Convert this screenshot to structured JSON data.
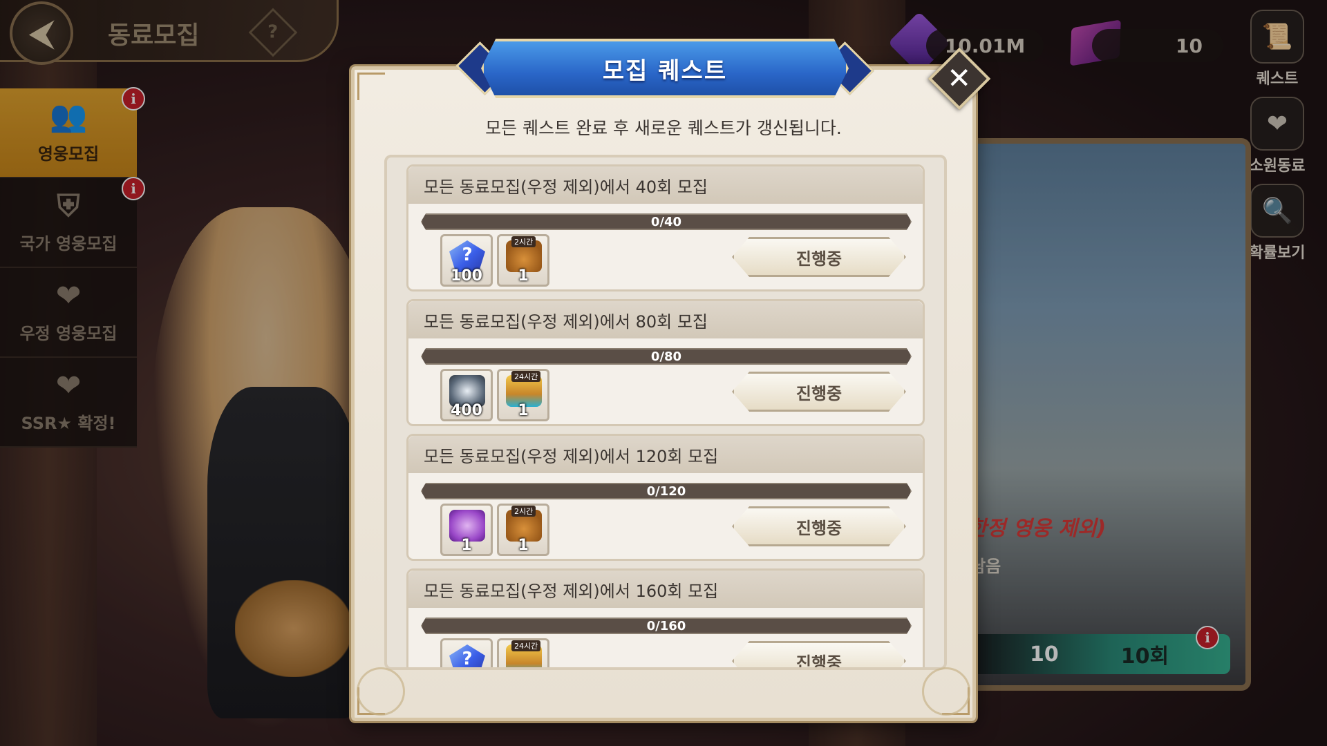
{
  "header": {
    "back_icon": "back-arrow-icon",
    "title": "동료모집",
    "help_label": "?"
  },
  "sidebar": {
    "items": [
      {
        "label": "영웅모집",
        "icon": "heroes-icon",
        "glyph": "👥",
        "active": true,
        "badge": "i"
      },
      {
        "label": "국가 영웅모집",
        "icon": "crest-icon",
        "glyph": "⛨",
        "active": false,
        "badge": "i"
      },
      {
        "label": "우정 영웅모집",
        "icon": "hearts-icon",
        "glyph": "❤",
        "active": false,
        "badge": ""
      },
      {
        "label": "SSR★ 확정!",
        "icon": "hearts-icon",
        "glyph": "❤",
        "active": false,
        "badge": ""
      }
    ]
  },
  "resources": {
    "gem": {
      "icon": "purple-gem-icon",
      "value": "10.01M"
    },
    "ticket": {
      "icon": "recruit-ticket-icon",
      "value": "10"
    }
  },
  "right_menu": [
    {
      "label": "퀘스트",
      "icon": "quest-scroll-icon",
      "glyph": "📜"
    },
    {
      "label": "소원동료",
      "icon": "wish-card-icon",
      "glyph": "❤"
    },
    {
      "label": "확률보기",
      "icon": "probability-search-icon",
      "glyph": "🔍"
    }
  ],
  "banner": {
    "text": "한정 영웅 제외)",
    "sub": "남음",
    "ticket_count": "10",
    "recruit_label": "10회",
    "badge": "i"
  },
  "modal": {
    "title": "모집 퀘스트",
    "subtitle": "모든 퀘스트 완료 후 새로운 퀘스트가 갱신됩니다.",
    "close_icon": "close-icon",
    "quests": [
      {
        "description": "모든 동료모집(우정 제외)에서 40회 모집",
        "progress_text": "0/40",
        "progress": 0,
        "rewards": [
          {
            "icon": "mystery-crystal-icon",
            "count": "100",
            "tag": ""
          },
          {
            "icon": "gold-pouch-icon",
            "count": "1",
            "tag": "2시간"
          }
        ],
        "button": "진행중"
      },
      {
        "description": "모든 동료모집(우정 제외)에서 80회 모집",
        "progress_text": "0/80",
        "progress": 0,
        "rewards": [
          {
            "icon": "silver-coin-icon",
            "count": "400",
            "tag": ""
          },
          {
            "icon": "treasure-chest-icon",
            "count": "1",
            "tag": "24시간"
          }
        ],
        "button": "진행중"
      },
      {
        "description": "모든 동료모집(우정 제외)에서 120회 모집",
        "progress_text": "0/120",
        "progress": 0,
        "rewards": [
          {
            "icon": "purple-hammer-icon",
            "count": "1",
            "tag": ""
          },
          {
            "icon": "gold-pouch-icon",
            "count": "1",
            "tag": "2시간"
          }
        ],
        "button": "진행중"
      },
      {
        "description": "모든 동료모집(우정 제외)에서 160회 모집",
        "progress_text": "0/160",
        "progress": 0,
        "rewards": [
          {
            "icon": "mystery-crystal-icon",
            "count": "",
            "tag": ""
          },
          {
            "icon": "treasure-chest-icon",
            "count": "",
            "tag": "24시간"
          }
        ],
        "button": "진행중"
      }
    ]
  }
}
